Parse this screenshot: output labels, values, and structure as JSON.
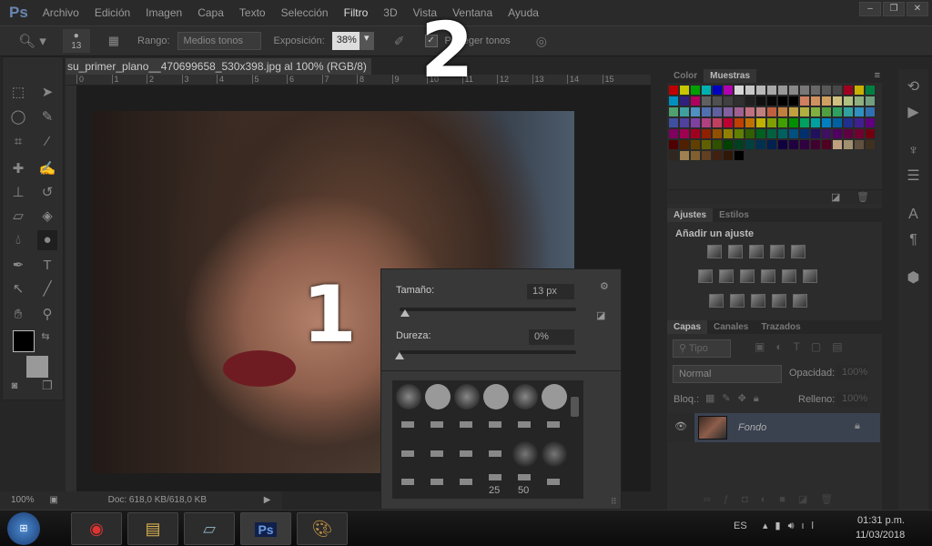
{
  "app": {
    "logo": "Ps"
  },
  "menu": [
    "Archivo",
    "Edición",
    "Imagen",
    "Capa",
    "Texto",
    "Selección",
    "Filtro",
    "3D",
    "Vista",
    "Ventana",
    "Ayuda"
  ],
  "options": {
    "brush_size": "13",
    "range_label": "Rango:",
    "range_value": "Medios tonos",
    "exposure_label": "Exposición:",
    "exposure_value": "38%",
    "protect_label": "Proteger tonos",
    "protect_checked": true
  },
  "document": {
    "tab_title": "su_primer_plano__470699658_530x398.jpg al 100% (RGB/8) *",
    "ruler_ticks": [
      "0",
      "1",
      "2",
      "3",
      "4",
      "5",
      "6",
      "7",
      "8",
      "9",
      "10",
      "11",
      "12",
      "13",
      "14",
      "15"
    ]
  },
  "annotations": {
    "one": "1",
    "two": "2"
  },
  "status": {
    "zoom": "100%",
    "doc": "Doc: 618,0 KB/618,0 KB"
  },
  "brush_popup": {
    "size_label": "Tamaño:",
    "size_value": "13 px",
    "size_fraction": 0.03,
    "hardness_label": "Dureza:",
    "hardness_value": "0%",
    "hardness_fraction": 0,
    "preset_labels": [
      "25",
      "50"
    ]
  },
  "swatches_panel": {
    "tabs": [
      "Color",
      "Muestras"
    ],
    "active": "Muestras",
    "colors": [
      "#c00000",
      "#c8c800",
      "#00a000",
      "#00b0b0",
      "#0000c0",
      "#b000b0",
      "#d8d8d8",
      "#c8c8c8",
      "#b8b8b8",
      "#a8a8a8",
      "#989898",
      "#888888",
      "#787878",
      "#686868",
      "#585858",
      "#484848",
      "#a00020",
      "#c8b000",
      "#008040",
      "#0090c0",
      "#302080",
      "#b00060",
      "#606060",
      "#505050",
      "#404040",
      "#303030",
      "#202020",
      "#101010",
      "#080808",
      "#000000",
      "#000000",
      "#d08060",
      "#d09060",
      "#d0a060",
      "#d0c080",
      "#b0c080",
      "#90b080",
      "#70a080",
      "#50a070",
      "#40a0a0",
      "#5090c0",
      "#5070b0",
      "#6060a0",
      "#8060a0",
      "#a06090",
      "#c07080",
      "#c08080",
      "#c06040",
      "#c08040",
      "#c0a040",
      "#b0b040",
      "#80b040",
      "#50a040",
      "#30a060",
      "#30a0a0",
      "#3090c0",
      "#3070b0",
      "#4050a0",
      "#5040a0",
      "#8040a0",
      "#b04080",
      "#c04060",
      "#c00030",
      "#c04000",
      "#c07000",
      "#c0b000",
      "#80a000",
      "#40a000",
      "#009000",
      "#00a060",
      "#00a0a0",
      "#0080c0",
      "#0060a0",
      "#203090",
      "#402090",
      "#600080",
      "#800060",
      "#a00050",
      "#a00020",
      "#902000",
      "#905000",
      "#908000",
      "#608000",
      "#306000",
      "#006020",
      "#006040",
      "#006060",
      "#005080",
      "#003070",
      "#201060",
      "#401060",
      "#500060",
      "#600040",
      "#700030",
      "#700010",
      "#500000",
      "#502000",
      "#604000",
      "#606000",
      "#305000",
      "#004000",
      "#004020",
      "#004040",
      "#003050",
      "#002050",
      "#100040",
      "#200040",
      "#300040",
      "#400030",
      "#500020",
      "#c0a080",
      "#a09070",
      "#605040",
      "#403020",
      "#302820",
      "#a08050",
      "#806030",
      "#604020",
      "#402010",
      "#301808",
      "#000000"
    ]
  },
  "adjustments_panel": {
    "tabs": [
      "Ajustes",
      "Estilos"
    ],
    "active": "Ajustes",
    "title": "Añadir un ajuste"
  },
  "layers_panel": {
    "tabs": [
      "Capas",
      "Canales",
      "Trazados"
    ],
    "active": "Capas",
    "filter": "Tipo",
    "blend_mode": "Normal",
    "opacity_label": "Opacidad:",
    "opacity_value": "100%",
    "lock_label": "Bloq.:",
    "fill_label": "Relleno:",
    "fill_value": "100%",
    "layers": [
      {
        "name": "Fondo",
        "visible": true,
        "locked": true
      }
    ]
  },
  "taskbar": {
    "language": "ES",
    "time": "01:31 p.m.",
    "date": "11/03/2018",
    "apps": [
      "chrome-icon",
      "file-explorer-icon",
      "notepad-icon",
      "photoshop-icon",
      "paint-icon"
    ]
  }
}
